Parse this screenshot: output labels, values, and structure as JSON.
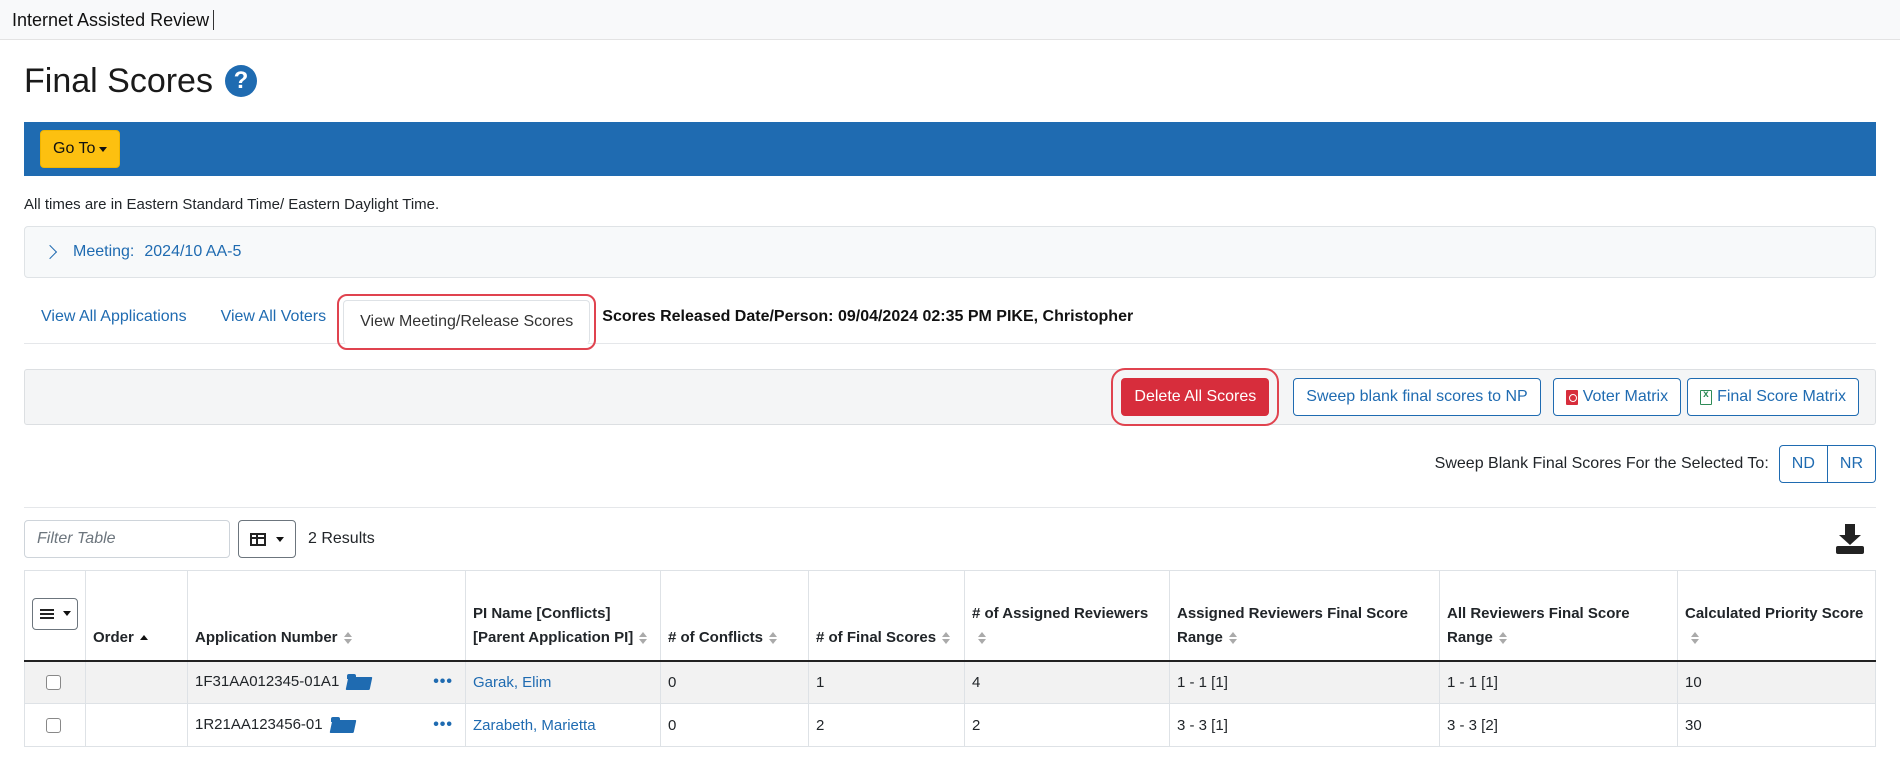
{
  "app": {
    "title": "Internet Assisted Review"
  },
  "page": {
    "title": "Final Scores",
    "help_symbol": "?"
  },
  "banner": {
    "goto_label": "Go To"
  },
  "timezone_note": "All times are in Eastern Standard Time/ Eastern Daylight Time.",
  "meeting": {
    "label": "Meeting:",
    "value": "2024/10 AA-5"
  },
  "tabs": [
    {
      "label": "View All Applications",
      "active": false
    },
    {
      "label": "View All Voters",
      "active": false
    },
    {
      "label": "View Meeting/Release Scores",
      "active": true
    }
  ],
  "scores_released": "Scores Released Date/Person: 09/04/2024 02:35 PM PIKE, Christopher",
  "toolbar": {
    "delete_all": "Delete All Scores",
    "sweep_np": "Sweep blank final scores to NP",
    "voter_matrix": "Voter Matrix",
    "final_score_matrix": "Final Score Matrix"
  },
  "sweep": {
    "label": "Sweep Blank Final Scores For the Selected To:",
    "options": [
      "ND",
      "NR"
    ]
  },
  "filter": {
    "placeholder": "Filter Table",
    "results": "2 Results"
  },
  "table": {
    "headers": [
      "Order",
      "Application Number",
      "PI Name [Conflicts] [Parent Application PI]",
      "# of Conflicts",
      "# of Final Scores",
      "# of Assigned Reviewers",
      "Assigned Reviewers Final Score Range",
      "All Reviewers Final Score Range",
      "Calculated Priority Score"
    ],
    "rows": [
      {
        "order": "",
        "app_number": "1F31AA012345-01A1",
        "pi_name": "Garak, Elim",
        "conflicts": "0",
        "final_scores": "1",
        "assigned_reviewers": "4",
        "assigned_range": "1 - 1 [1]",
        "all_range": "1 - 1 [1]",
        "priority": "10"
      },
      {
        "order": "",
        "app_number": "1R21AA123456-01",
        "pi_name": "Zarabeth, Marietta",
        "conflicts": "0",
        "final_scores": "2",
        "assigned_reviewers": "2",
        "assigned_range": "3 - 3 [1]",
        "all_range": "3 - 3 [2]",
        "priority": "30"
      }
    ]
  },
  "colors": {
    "brand_blue": "#1f6bb1",
    "goto_yellow": "#fdc010",
    "danger_red": "#d72d3c",
    "highlight_red": "#e0434f"
  }
}
